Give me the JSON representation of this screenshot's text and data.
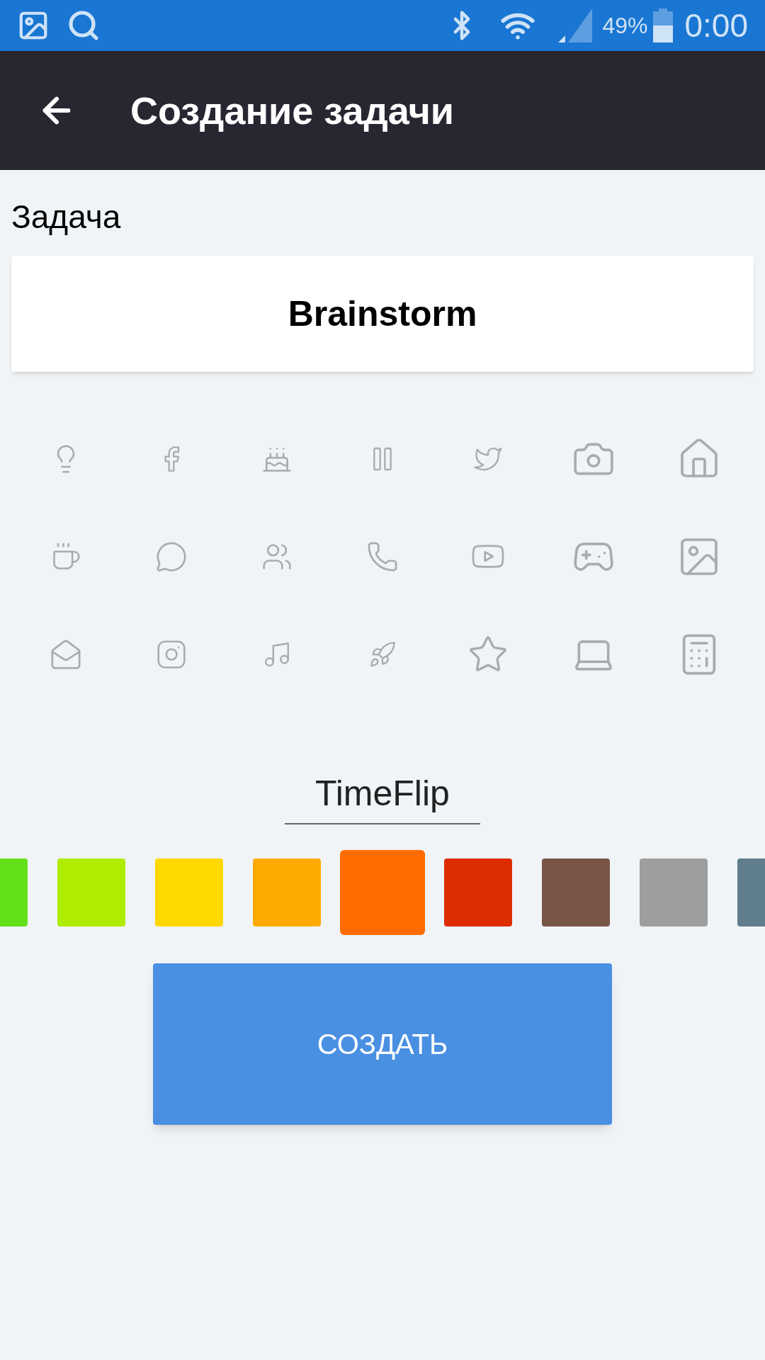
{
  "status_bar": {
    "battery": "49%",
    "time": "0:00"
  },
  "app_bar": {
    "title": "Создание задачи"
  },
  "task": {
    "label": "Задача",
    "value": "Brainstorm"
  },
  "name_field": {
    "value": "TimeFlip"
  },
  "colors": [
    {
      "color": "#64e01a",
      "selected": false
    },
    {
      "color": "#afec00",
      "selected": false
    },
    {
      "color": "#ffd800",
      "selected": false
    },
    {
      "color": "#ffaa00",
      "selected": false
    },
    {
      "color": "#ff6d00",
      "selected": true
    },
    {
      "color": "#dd2c00",
      "selected": false
    },
    {
      "color": "#795548",
      "selected": false
    },
    {
      "color": "#9e9e9e",
      "selected": false
    },
    {
      "color": "#607d8b",
      "selected": false
    }
  ],
  "create_button": {
    "label": "СОЗДАТЬ"
  }
}
